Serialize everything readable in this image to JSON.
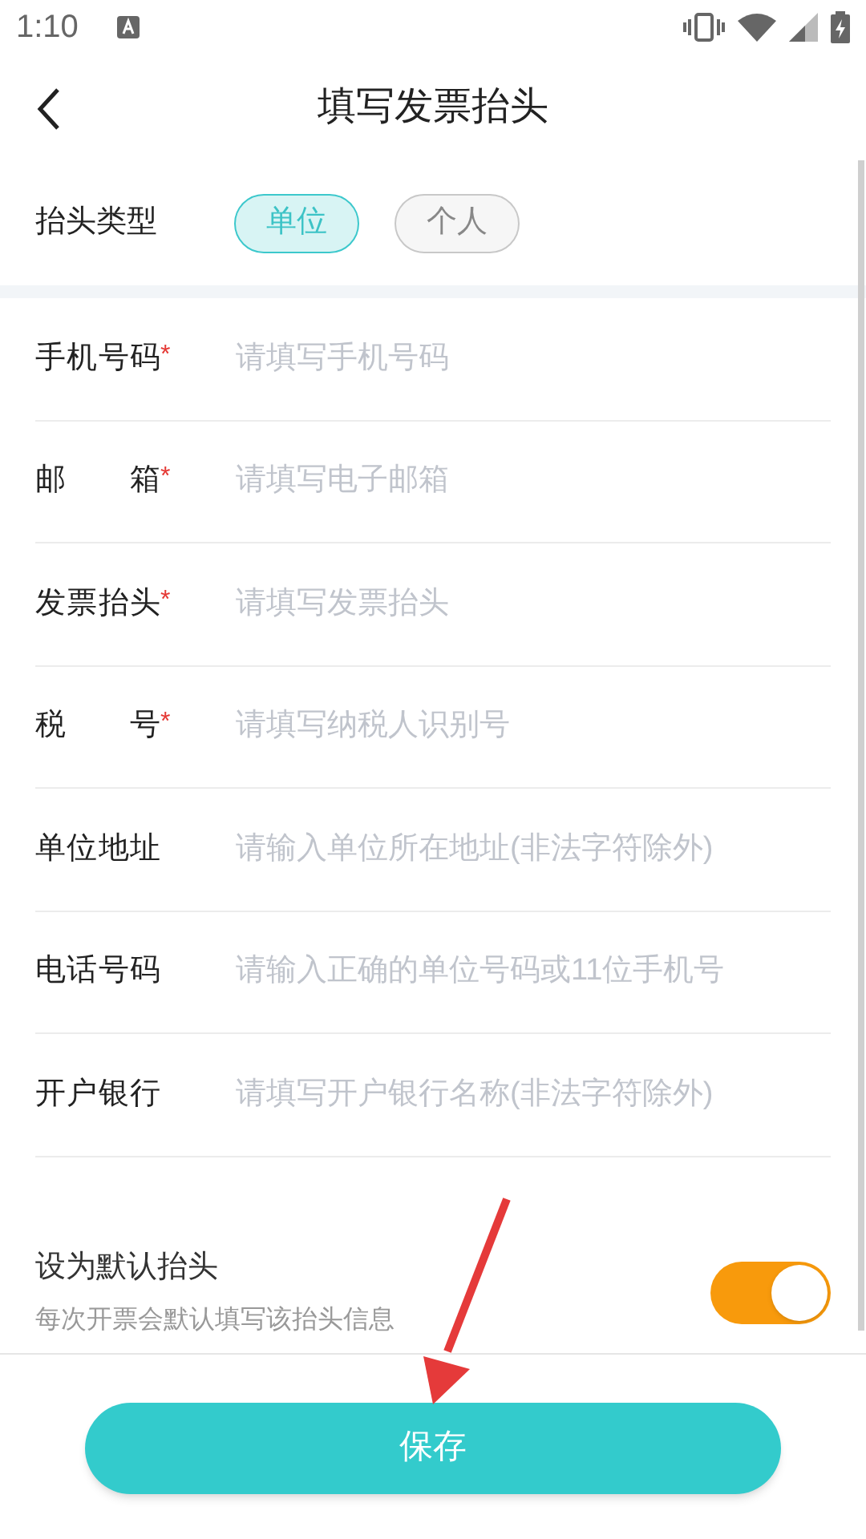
{
  "status_bar": {
    "time": "1:10"
  },
  "header": {
    "title": "填写发票抬头"
  },
  "title_type": {
    "label": "抬头类型",
    "options": [
      {
        "label": "单位",
        "selected": true
      },
      {
        "label": "个人",
        "selected": false
      }
    ]
  },
  "fields": [
    {
      "label": "手机号码",
      "required_mark": "*",
      "placeholder": "请填写手机号码"
    },
    {
      "label": "邮箱",
      "required_mark": "*",
      "placeholder": "请填写电子邮箱"
    },
    {
      "label": "发票抬头",
      "required_mark": "*",
      "placeholder": "请填写发票抬头"
    },
    {
      "label": "税号",
      "required_mark": "*",
      "placeholder": "请填写纳税人识别号"
    },
    {
      "label": "单位地址",
      "placeholder": "请输入单位所在地址(非法字符除外)"
    },
    {
      "label": "电话号码",
      "placeholder": "请输入正确的单位号码或11位手机号"
    },
    {
      "label": "开户银行",
      "placeholder": "请填写开户银行名称(非法字符除外)"
    }
  ],
  "default_setting": {
    "title": "设为默认抬头",
    "description": "每次开票会默认填写该抬头信息",
    "on": true
  },
  "save_button": {
    "label": "保存"
  }
}
